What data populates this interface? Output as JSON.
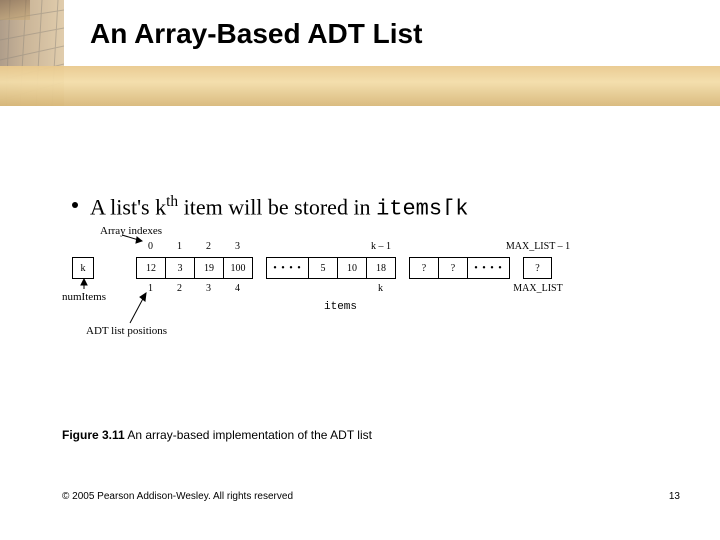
{
  "title": "An Array-Based ADT List",
  "bullet": {
    "prefix": "A list's k",
    "sup": "th",
    "mid": " item will be stored in ",
    "code": "items[k"
  },
  "diagram": {
    "label_indexes": "Array indexes",
    "label_numitems": "numItems",
    "label_positions": "ADT list positions",
    "label_items": "items",
    "k_box": "k",
    "cells": [
      "12",
      "3",
      "19",
      "100",
      "• • • •",
      "5",
      "10",
      "18",
      "?",
      "?",
      "• • • •",
      "?"
    ],
    "cell_dividers_after": [
      3,
      7,
      10
    ],
    "idx": [
      "0",
      "1",
      "2",
      "3",
      "",
      "",
      "",
      "k – 1",
      "",
      "",
      "",
      "MAX_LIST – 1"
    ],
    "pos": [
      "1",
      "2",
      "3",
      "4",
      "",
      "",
      "",
      "k",
      "",
      "",
      "",
      "MAX_LIST"
    ]
  },
  "caption": {
    "fig": "Figure 3.11",
    "text": "  An array-based implementation of the ADT list"
  },
  "footer": "© 2005 Pearson Addison-Wesley. All rights reserved",
  "page": "13"
}
